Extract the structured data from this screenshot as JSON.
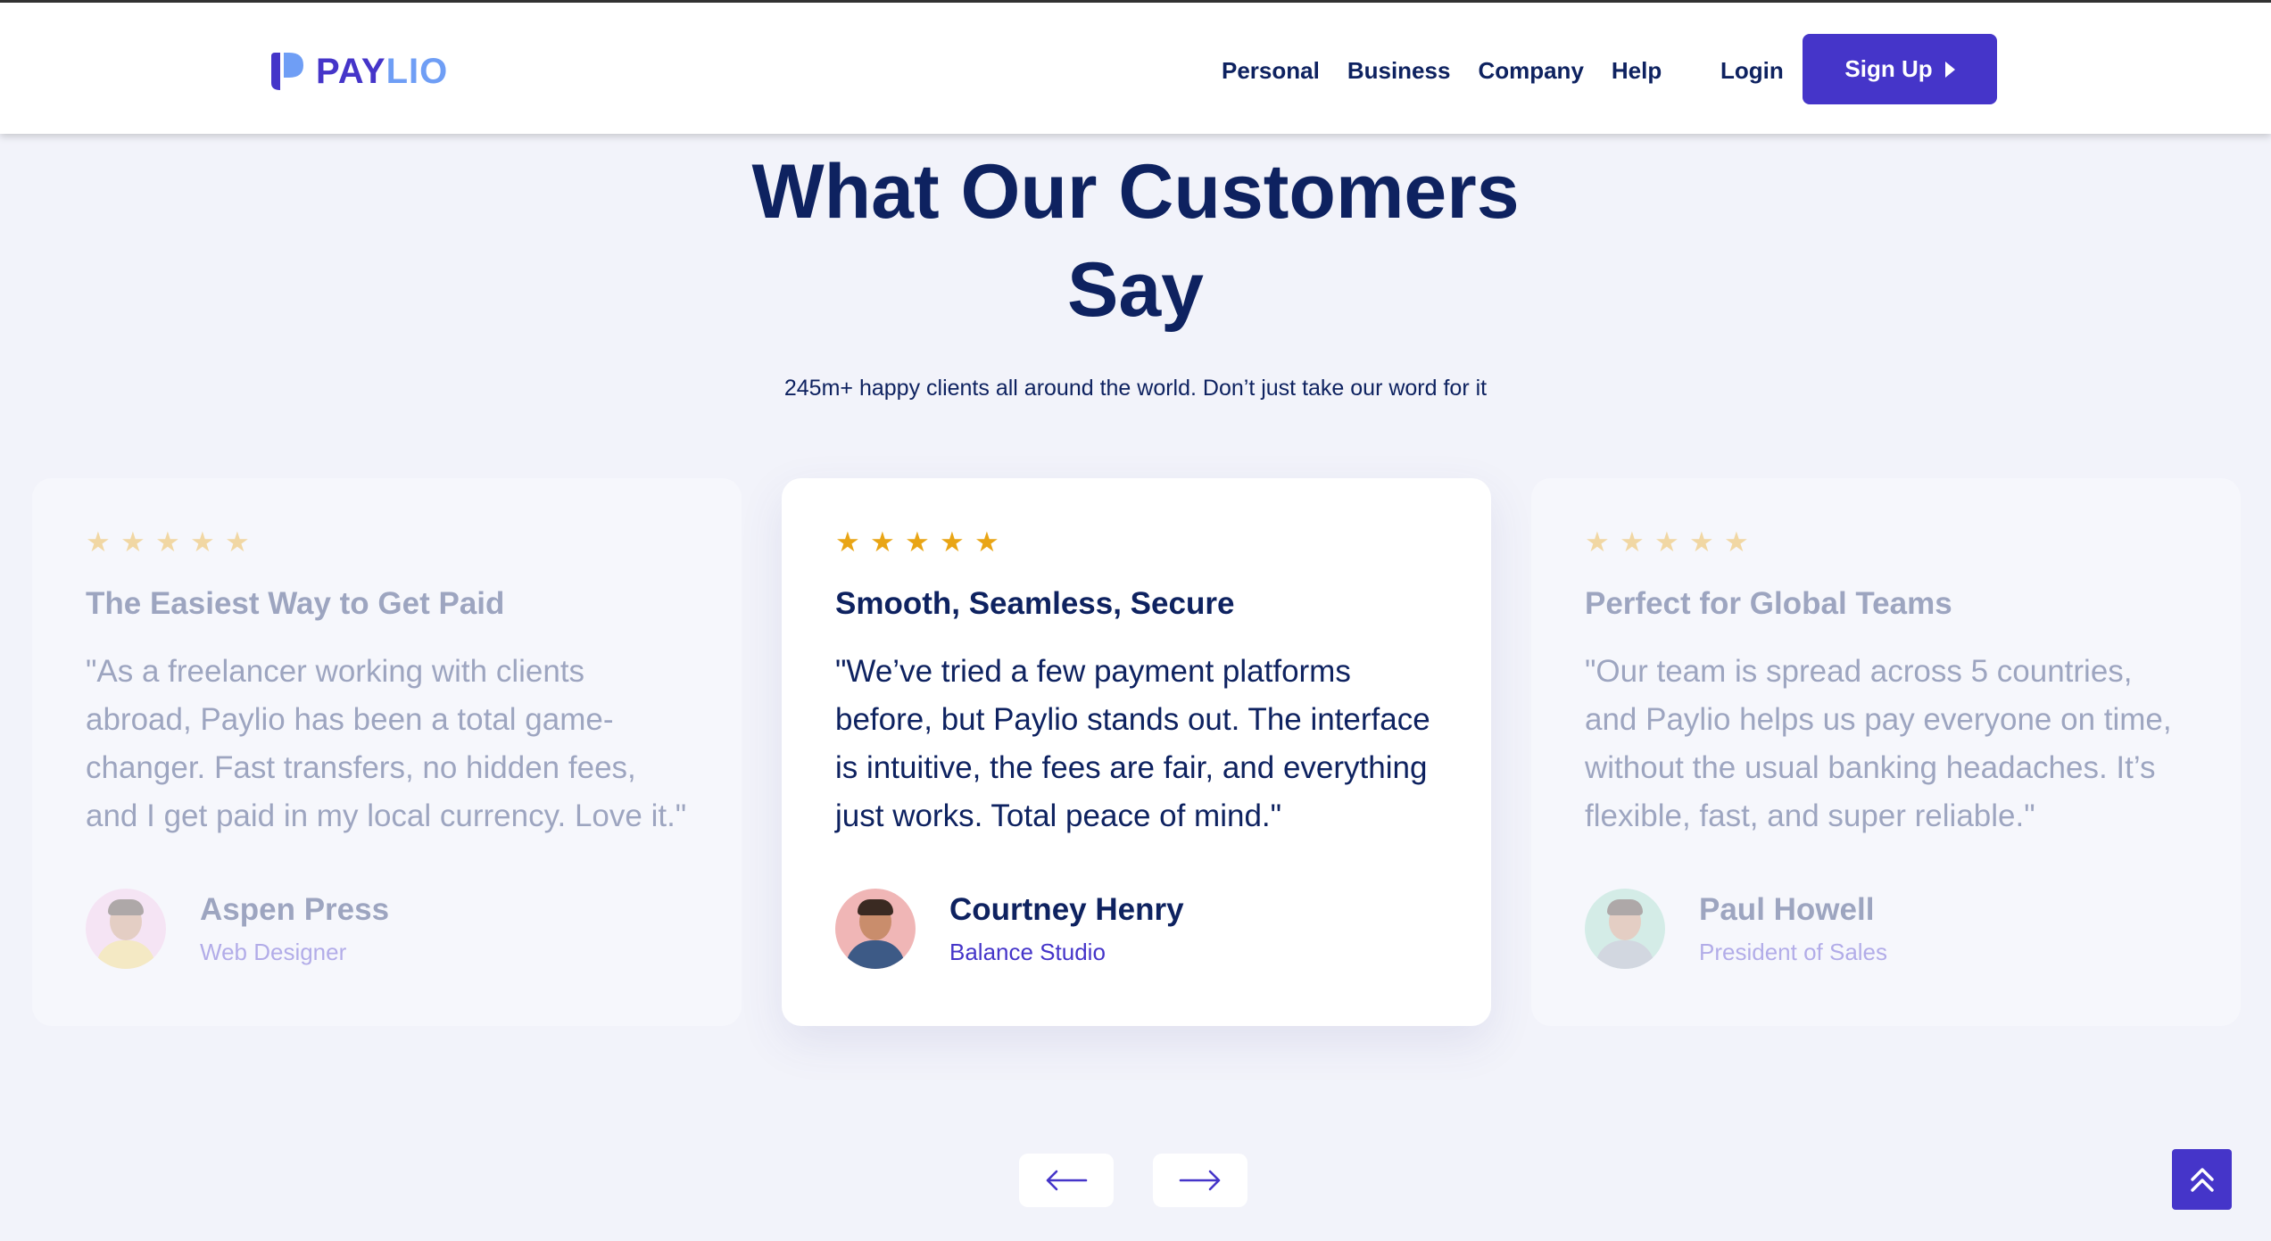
{
  "header": {
    "logo_text_a": "PAY",
    "logo_text_b": "LIO",
    "nav": [
      "Personal",
      "Business",
      "Company",
      "Help"
    ],
    "login_label": "Login",
    "signup_label": "Sign Up"
  },
  "section": {
    "title_line1": "What Our Customers",
    "title_line2": "Say",
    "subtitle": "245m+ happy clients all around the world. Don’t just take our word for it"
  },
  "testimonials": [
    {
      "rating": 5,
      "title": "The Easiest Way to Get Paid",
      "quote": "\"As a freelancer working with clients abroad, Paylio has been a total game-changer. Fast transfers, no hidden fees, and I get paid in my local currency. Love it.\"",
      "name": "Aspen Press",
      "role": "Web Designer"
    },
    {
      "rating": 5,
      "title": "Smooth, Seamless, Secure",
      "quote": "\"We’ve tried a few payment platforms before, but Paylio stands out. The interface is intuitive, the fees are fair, and everything just works. Total peace of mind.\"",
      "name": "Courtney Henry",
      "role": "Balance Studio"
    },
    {
      "rating": 5,
      "title": "Perfect for Global Teams",
      "quote": "\"Our team is spread across 5 countries, and Paylio helps us pay everyone on time, without the usual banking headaches. It’s flexible, fast, and super reliable.\"",
      "name": "Paul Howell",
      "role": "President of Sales"
    }
  ],
  "icons": {
    "prev": "arrow-left-icon",
    "next": "arrow-right-icon",
    "top": "double-chevron-up-icon",
    "star": "star-icon"
  },
  "colors": {
    "primary": "#4535c9",
    "logo_light": "#6f9ef5",
    "text_dark": "#0e2260",
    "star": "#e9a515",
    "background": "#f2f3fa"
  }
}
